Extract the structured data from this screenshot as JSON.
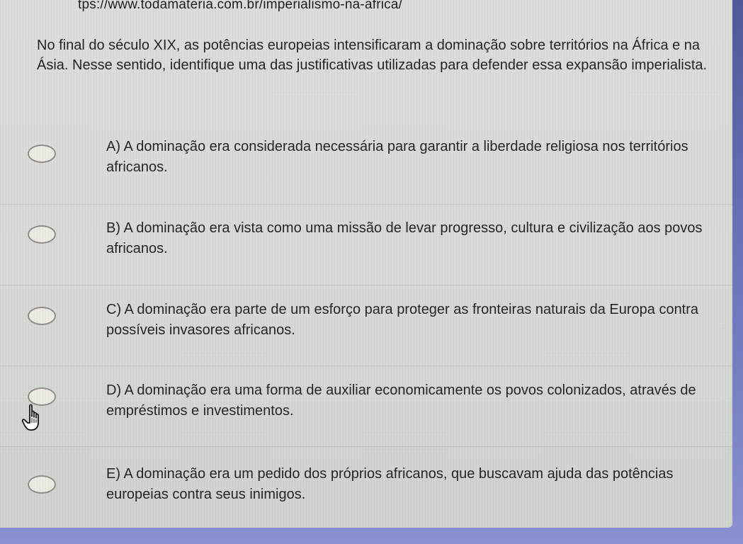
{
  "browser": {
    "url": "tps://www.todamateria.com.br/imperialismo-na-africa/"
  },
  "question": {
    "text": "No final do século XIX, as potências europeias intensificaram a dominação sobre territórios na África e na Ásia. Nesse sentido, identifique uma das justificativas utilizadas para defender essa expansão imperialista."
  },
  "options": [
    {
      "text": "A) A dominação era considerada necessária para garantir a liberdade religiosa nos territórios africanos."
    },
    {
      "text": "B) A dominação era vista como uma missão de levar progresso, cultura e civilização aos povos africanos."
    },
    {
      "text": "C) A dominação era parte de um esforço para proteger as fronteiras naturais da Europa contra possíveis invasores africanos."
    },
    {
      "text": "D) A dominação era uma forma de auxiliar economicamente os povos colonizados, através de empréstimos e investimentos."
    },
    {
      "text": "E) A dominação era um pedido dos próprios africanos, que buscavam ajuda das potências europeias contra seus inimigos."
    }
  ],
  "colors": {
    "page_background": "#d8d9d6",
    "radio_border": "#8e8f8c",
    "text": "#222222",
    "desk_background": "#6f76b8"
  },
  "icons": {
    "cursor": "hand-pointer-icon"
  }
}
